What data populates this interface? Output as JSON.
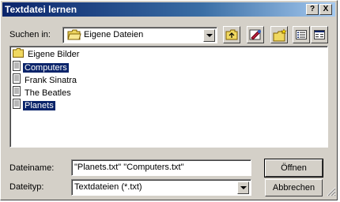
{
  "window": {
    "title": "Textdatei lernen",
    "help_label": "?",
    "close_label": "X"
  },
  "lookin": {
    "label": "Suchen in:",
    "value": "Eigene Dateien"
  },
  "files": [
    {
      "name": "Eigene Bilder",
      "type": "folder",
      "selected": false
    },
    {
      "name": "Computers",
      "type": "textfile",
      "selected": true
    },
    {
      "name": "Frank Sinatra",
      "type": "textfile",
      "selected": false
    },
    {
      "name": "The Beatles",
      "type": "textfile",
      "selected": false
    },
    {
      "name": "Planets",
      "type": "textfile",
      "selected": true
    }
  ],
  "filename": {
    "label": "Dateiname:",
    "value": "\"Planets.txt\" \"Computers.txt\""
  },
  "filetype": {
    "label": "Dateityp:",
    "value": "Textdateien (*.txt)"
  },
  "buttons": {
    "open": "Öffnen",
    "cancel": "Abbrechen"
  },
  "colors": {
    "title_start": "#0a246a",
    "title_end": "#a6caf0",
    "face": "#d4d0c8",
    "selection": "#0a246a"
  }
}
